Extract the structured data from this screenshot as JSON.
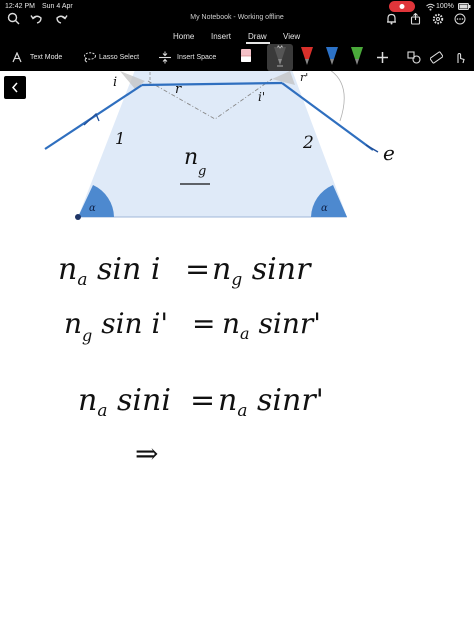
{
  "status_bar": {
    "time": "12:42 PM",
    "date": "Sun 4 Apr",
    "battery": "100%"
  },
  "window": {
    "title": "My Notebook - Working offline"
  },
  "menu": {
    "tabs": [
      "Home",
      "Insert",
      "Draw",
      "View"
    ],
    "active_tab": "Draw"
  },
  "toolbar": {
    "text_mode": "Text Mode",
    "lasso_select": "Lasso Select",
    "insert_space": "Insert Space",
    "pen_colors": [
      "#555555",
      "#d9302b",
      "#2c72c7",
      "#4aa93a"
    ]
  },
  "drawing": {
    "ray_label_1": "1",
    "ray_label_2": "2",
    "angle_i": "i",
    "angle_r": "r",
    "angle_i_prime": "i'",
    "angle_r_prime": "r'",
    "e_label": "e",
    "medium": "n",
    "medium_sub": "g",
    "alpha_left": "α",
    "alpha_right": "α"
  },
  "equations": {
    "eq1": {
      "lhs": "n",
      "lhs_sub": "a",
      "lhs_fn": " sin i",
      "rhs": "n",
      "rhs_sub": "g",
      "rhs_fn": " sinr"
    },
    "eq2": {
      "lhs": "n",
      "lhs_sub": "g",
      "lhs_fn": " sin i'",
      "rhs": "n",
      "rhs_sub": "a",
      "rhs_fn": " sinr'"
    },
    "eq3": {
      "lhs": "n",
      "lhs_sub": "a",
      "lhs_fn": " sini",
      "rhs": "n",
      "rhs_sub": "a",
      "rhs_fn": " sinr'"
    },
    "implies": "⇒"
  }
}
